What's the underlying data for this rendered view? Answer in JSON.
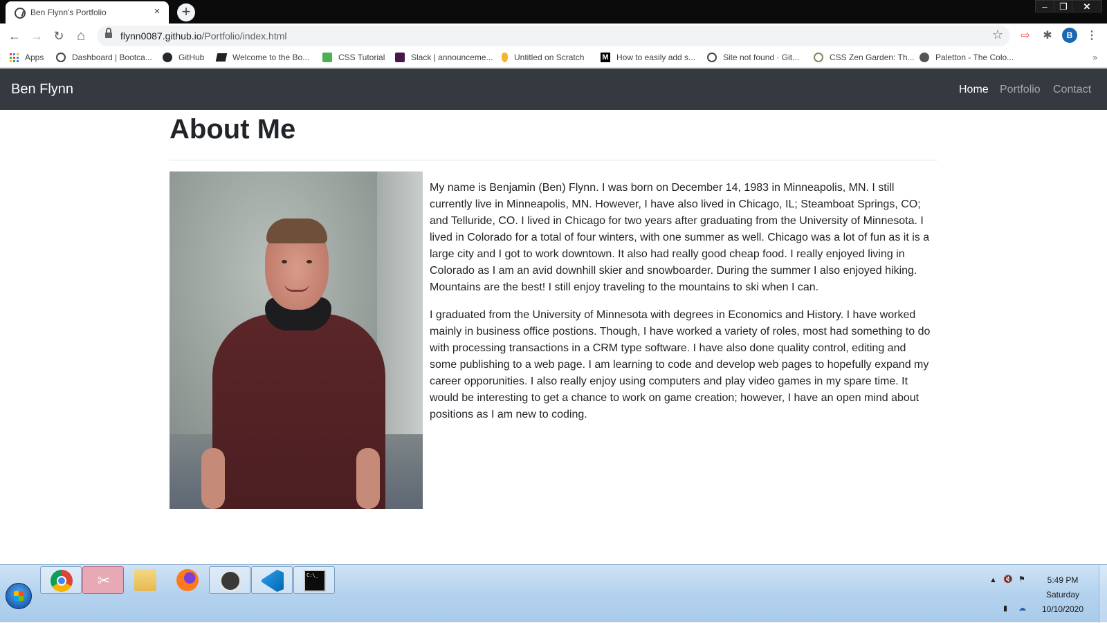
{
  "browser": {
    "tab_title": "Ben Flynn's Portfolio",
    "tab_close": "×",
    "new_tab": "+",
    "url_host": "flynn0087.github.io",
    "url_path": "/Portfolio/index.html",
    "profile_initial": "B",
    "window": {
      "minimize": "–",
      "maximize": "❐",
      "close": "✕"
    },
    "nav": {
      "back": "←",
      "forward": "→",
      "reload": "↻",
      "home": "⌂"
    },
    "bookmarks": [
      {
        "label": "Apps",
        "icon": "apps-grid-icon"
      },
      {
        "label": "Dashboard | Bootca...",
        "icon": "globe-icon"
      },
      {
        "label": "GitHub",
        "icon": "github-icon"
      },
      {
        "label": "Welcome to the Bo...",
        "icon": "book-icon"
      },
      {
        "label": "CSS Tutorial",
        "icon": "w3-icon"
      },
      {
        "label": "Slack | announceme...",
        "icon": "slack-icon"
      },
      {
        "label": "Untitled on Scratch",
        "icon": "scratch-icon"
      },
      {
        "label": "How to easily add s...",
        "icon": "medium-icon"
      },
      {
        "label": "Site not found · Git...",
        "icon": "globe-icon"
      },
      {
        "label": "CSS Zen Garden: Th...",
        "icon": "zen-icon"
      },
      {
        "label": "Paletton - The Colo...",
        "icon": "paletton-icon"
      }
    ],
    "bookmarks_more": "»"
  },
  "site": {
    "brand": "Ben Flynn",
    "nav": [
      {
        "label": "Home",
        "active": true
      },
      {
        "label": "Portfolio",
        "active": false
      },
      {
        "label": "Contact",
        "active": false
      }
    ],
    "heading": "About Me",
    "bio": [
      "My name is Benjamin (Ben) Flynn. I was born on December 14, 1983 in Minneapolis, MN. I still currently live in Minneapolis, MN. However, I have also lived in Chicago, IL; Steamboat Springs, CO; and Telluride, CO. I lived in Chicago for two years after graduating from the University of Minnesota. I lived in Colorado for a total of four winters, with one summer as well. Chicago was a lot of fun as it is a large city and I got to work downtown. It also had really good cheap food. I really enjoyed living in Colorado as I am an avid downhill skier and snowboarder. During the summer I also enjoyed hiking. Mountains are the best! I still enjoy traveling to the mountains to ski when I can.",
      "I graduated from the University of Minnesota with degrees in Economics and History. I have worked mainly in business office postions. Though, I have worked a variety of roles, most had something to do with processing transactions in a CRM type software. I have also done quality control, editing and some publishing to a web page. I am learning to code and develop web pages to hopefully expand my career opporunities. I also really enjoy using computers and play video games in my spare time. It would be interesting to get a chance to work on game creation; however, I have an open mind about positions as I am new to coding."
    ]
  },
  "taskbar": {
    "apps": [
      "chrome-icon",
      "snipping-tool-icon",
      "file-explorer-icon",
      "firefox-icon",
      "obs-icon",
      "vscode-icon",
      "command-prompt-icon"
    ],
    "time": "5:49 PM",
    "day": "Saturday",
    "date": "10/10/2020"
  },
  "colors": {
    "navbar": "#343a40",
    "text": "#212529",
    "nav_link_muted": "rgba(255,255,255,.55)",
    "profile": "#1a67b4"
  }
}
